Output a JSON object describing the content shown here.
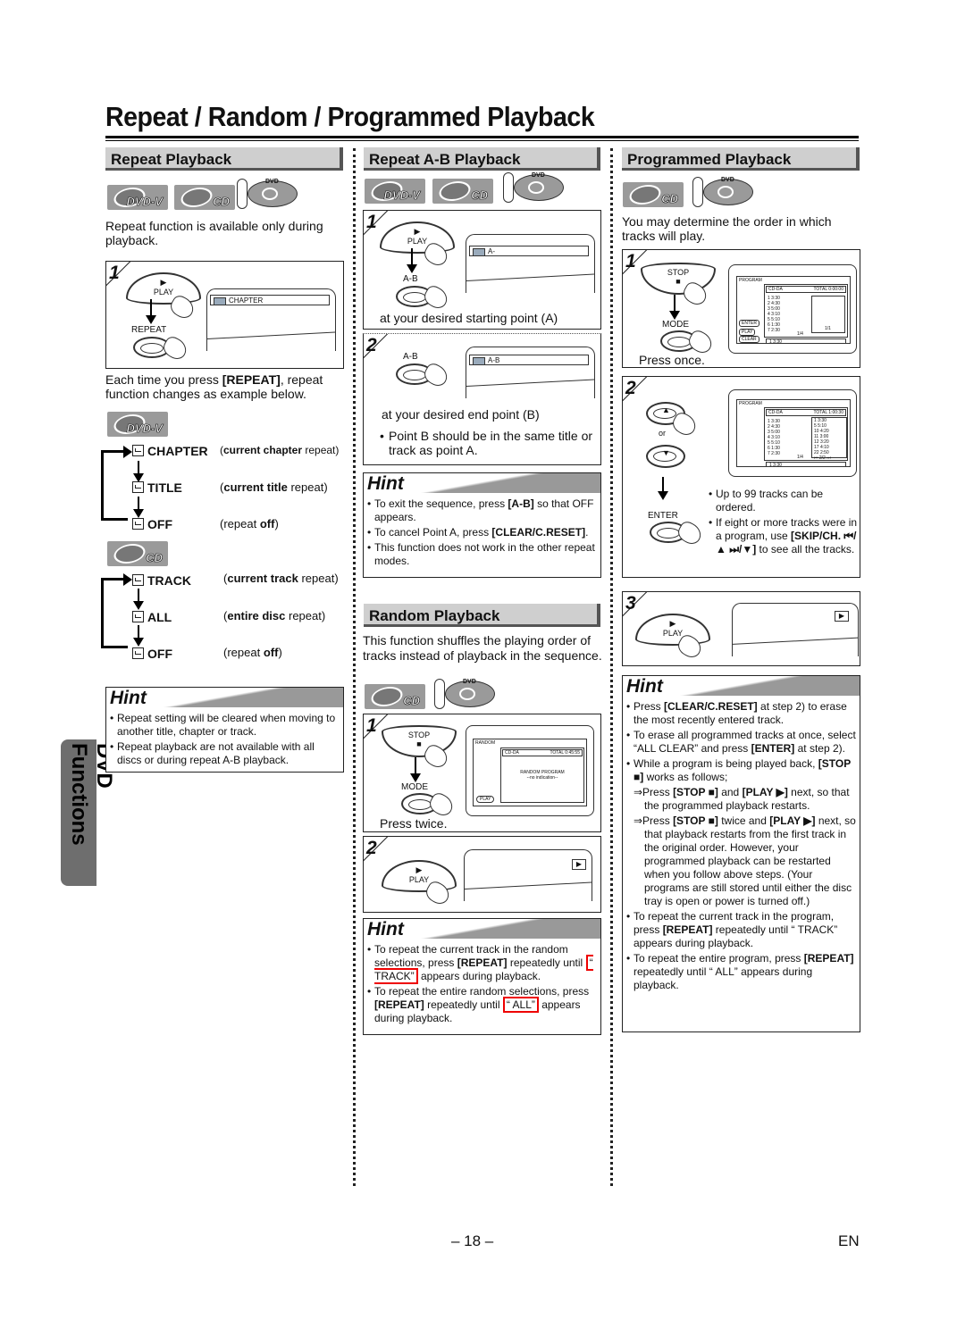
{
  "page": {
    "title": "Repeat / Random / Programmed Playback",
    "side_tab": "DVD Functions",
    "page_number": "– 18 –",
    "language": "EN"
  },
  "repeat": {
    "heading": "Repeat Playback",
    "badges": [
      "DVD-V",
      "CD"
    ],
    "intro": "Repeat function is available only during playback.",
    "step1": {
      "number": "1",
      "play_label": "PLAY",
      "repeat_label": "REPEAT",
      "osd_text": "CHAPTER"
    },
    "cycle_intro_pre": "Each time you press ",
    "cycle_intro_key": "[REPEAT]",
    "cycle_intro_post": ", repeat function changes as example below.",
    "dvd_cycle": {
      "badge": "DVD-V",
      "items": [
        {
          "label": "CHAPTER",
          "desc_bold": "current chapter",
          "desc_rest": " repeat"
        },
        {
          "label": "TITLE",
          "desc_bold": "current title",
          "desc_rest": " repeat"
        },
        {
          "label": "OFF",
          "desc_pre": "repeat ",
          "desc_bold": "off"
        }
      ]
    },
    "cd_cycle": {
      "badge": "CD",
      "items": [
        {
          "label": "TRACK",
          "desc_bold": "current track",
          "desc_rest": " repeat"
        },
        {
          "label": "ALL",
          "desc_bold": "entire disc",
          "desc_rest": " repeat"
        },
        {
          "label": "OFF",
          "desc_pre": "repeat ",
          "desc_bold": "off"
        }
      ]
    },
    "hint": {
      "title": "Hint",
      "items": [
        "Repeat setting will be cleared when moving to another title, chapter or track.",
        "Repeat playback are not available with all discs or during repeat A-B playback."
      ]
    }
  },
  "ab": {
    "heading": "Repeat A-B Playback",
    "badges": [
      "DVD-V",
      "CD"
    ],
    "step1": {
      "number": "1",
      "play_label": "PLAY",
      "ab_label": "A-B",
      "osd_text": "A-",
      "caption": "at your desired starting point (A)"
    },
    "step2": {
      "number": "2",
      "ab_label": "A-B",
      "osd_text": "A-B",
      "caption": "at your desired end point (B)",
      "note": "Point B should be in the same title or track as point A."
    },
    "hint": {
      "title": "Hint",
      "items": [
        {
          "pre": "To exit the sequence, press ",
          "key": "[A-B]",
          "post": " so that OFF appears."
        },
        {
          "pre": "To cancel Point A, press ",
          "key": "[CLEAR/C.RESET]",
          "post": "."
        },
        {
          "pre": "This function does not work in the other repeat modes.",
          "key": "",
          "post": ""
        }
      ]
    }
  },
  "random": {
    "heading": "Random Playback",
    "intro": "This function shuffles the playing order of tracks instead of playback in the sequence.",
    "badges": [
      "CD"
    ],
    "step1": {
      "number": "1",
      "stop_label": "STOP",
      "mode_label": "MODE",
      "caption": "Press twice.",
      "screen": {
        "title": "RANDOM",
        "disc": "CD-DA",
        "total": "TOTAL 0:45:55",
        "line1": "RANDOM PROGRAM",
        "line2": "--no indication--",
        "button": "PLAY"
      }
    },
    "step2": {
      "number": "2",
      "play_label": "PLAY",
      "osd_symbol": "▶"
    },
    "hint": {
      "title": "Hint",
      "items": [
        {
          "pre": "To repeat the current track in the random selections, press ",
          "key": "[REPEAT]",
          "post": " repeatedly until ",
          "boxed": "“ TRACK”",
          "end": " appears during playback."
        },
        {
          "pre": "To repeat the entire random selections, press ",
          "key": "[REPEAT]",
          "post": " repeatedly until ",
          "boxed": "“ ALL”",
          "end": " appears during playback."
        }
      ]
    }
  },
  "programmed": {
    "heading": "Programmed Playback",
    "badges": [
      "CD"
    ],
    "intro": "You may determine the order in which tracks will play.",
    "step1": {
      "number": "1",
      "stop_label": "STOP",
      "mode_label": "MODE",
      "caption": "Press once.",
      "screen": {
        "title": "PROGRAM",
        "disc": "CD-DA",
        "total": "TOTAL 0:00:00",
        "tracks": [
          "1  3:30",
          "2  4:30",
          "3  5:00",
          "4  3:10",
          "5  5:10",
          "6  1:30",
          "7  2:30"
        ],
        "page": "1/4",
        "right_page": "1/1",
        "selected": "1  3:30",
        "buttons": [
          "ENTER",
          "PLAY",
          "CLEAR"
        ]
      }
    },
    "step2": {
      "number": "2",
      "or_label": "or",
      "enter_label": "ENTER",
      "screen": {
        "title": "PROGRAM",
        "disc": "CD-DA",
        "total": "TOTAL 1:00:30",
        "tracks": [
          "1  3:30",
          "2  4:30",
          "3  5:00",
          "4  3:10",
          "5  5:10",
          "6  1:30",
          "7  2:30"
        ],
        "program": [
          "1  3:30",
          "5  5:10",
          "10  4:20",
          "11  3:00",
          "12  3:20",
          "17  4:10",
          "22  2:50"
        ],
        "page": "1/4",
        "right_page": "2/2",
        "selected": "1  3:30"
      },
      "notes": [
        {
          "text": "Up to 99 tracks can be ordered."
        },
        {
          "pre": "If eight or more tracks were in a program, use ",
          "key": "[SKIP/CH. ⏮/▲ ⏭/▼]",
          "post": " to see all the tracks."
        }
      ]
    },
    "step3": {
      "number": "3",
      "play_label": "PLAY",
      "osd_symbol": "▶"
    },
    "hint": {
      "title": "Hint",
      "items": [
        {
          "pre": "Press ",
          "key": "[CLEAR/C.RESET]",
          "post": " at step 2) to erase the most recently entered track."
        },
        {
          "pre": "To erase all programmed tracks at once, select “ALL CLEAR” and press ",
          "key": "[ENTER]",
          "post": " at step 2)."
        },
        {
          "pre": "While a program is being played back, ",
          "key": "[STOP ■]",
          "post": " works as follows;"
        },
        {
          "pre": "To repeat the current track in the program, press ",
          "key": "[REPEAT]",
          "post": " repeatedly until “ TRACK” appears during playback."
        },
        {
          "pre": "To repeat the entire program, press ",
          "key": "[REPEAT]",
          "post": " repeatedly until “ ALL” appears during playback."
        }
      ],
      "sub_items": [
        {
          "pre": "⇒Press ",
          "key1": "[STOP ■]",
          "mid": " and ",
          "key2": "[PLAY ▶]",
          "post": " next, so that the programmed playback restarts."
        },
        {
          "pre": "⇒Press ",
          "key1": "[STOP ■]",
          "mid": " twice and ",
          "key2": "[PLAY ▶]",
          "post": " next, so that playback restarts from the first track in the original order. However, your programmed playback can be restarted when you follow above steps. (Your programs are still stored until either the disc tray is open or power is turned off.)"
        }
      ]
    }
  }
}
